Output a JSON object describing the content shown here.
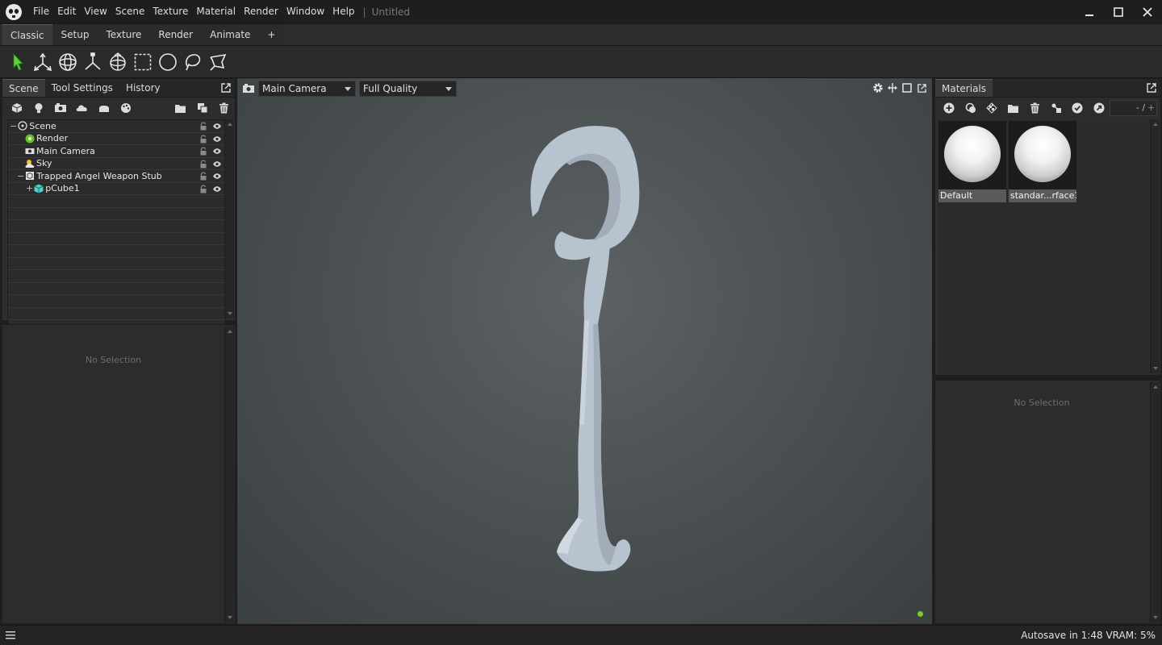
{
  "app": {
    "menu": [
      "File",
      "Edit",
      "View",
      "Scene",
      "Texture",
      "Material",
      "Render",
      "Window",
      "Help"
    ],
    "separator": "|",
    "doc_title": "Untitled"
  },
  "workspace_tabs": [
    "Classic",
    "Setup",
    "Texture",
    "Render",
    "Animate",
    "+"
  ],
  "tools": [
    "select-arrow-icon",
    "translate-icon",
    "rotate-icon",
    "scale-icon",
    "transform-gizmo-icon",
    "rect-select-icon",
    "circle-select-icon",
    "lasso-icon",
    "poly-lasso-icon"
  ],
  "left_panel": {
    "tabs": [
      "Scene",
      "Tool Settings",
      "History"
    ],
    "tree": [
      {
        "label": "Scene",
        "icon": "scene-icon"
      },
      {
        "label": "Render",
        "icon": "render-icon"
      },
      {
        "label": "Main Camera",
        "icon": "camera-icon"
      },
      {
        "label": "Sky",
        "icon": "sky-icon"
      },
      {
        "label": "Trapped Angel Weapon Stub",
        "icon": "model-icon"
      },
      {
        "label": "pCube1",
        "icon": "mesh-icon"
      }
    ],
    "properties_empty": "No Selection"
  },
  "viewport": {
    "camera": "Main Camera",
    "quality": "Full Quality"
  },
  "right_panel": {
    "tab": "Materials",
    "page_field": "- /",
    "materials": [
      {
        "name": "Default"
      },
      {
        "name": "standar...rface1"
      }
    ],
    "properties_empty": "No Selection"
  },
  "status": {
    "text": "Autosave in 1:48   VRAM: 5%"
  },
  "colors": {
    "accent_green": "#7acd1f",
    "mesh_color": "#b9c4d1"
  }
}
